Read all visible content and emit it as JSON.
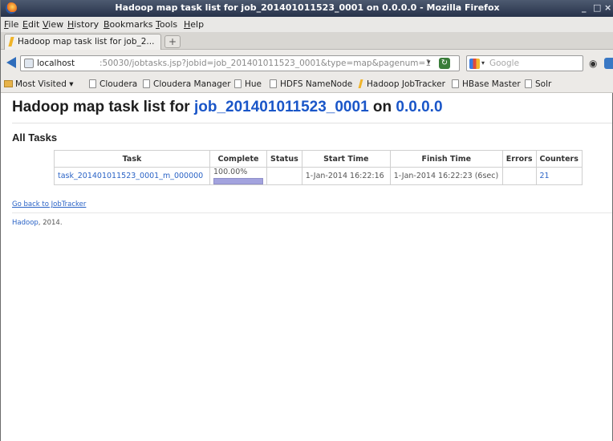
{
  "window": {
    "title": "Hadoop map task list for job_201401011523_0001 on 0.0.0.0 - Mozilla Firefox",
    "controls": [
      "_",
      "□",
      "×"
    ]
  },
  "menu": [
    "File",
    "Edit",
    "View",
    "History",
    "Bookmarks",
    "Tools",
    "Help"
  ],
  "tab": {
    "label": "Hadoop map task list for job_2...",
    "new_tab": "+"
  },
  "url": {
    "host": "localhost",
    "rest": ":50030/jobtasks.jsp?jobid=job_201401011523_0001&type=map&pagenum=1",
    "dropdown": "▾",
    "reload": "↻"
  },
  "search": {
    "placeholder": "Google"
  },
  "bookmarks": [
    "Most Visited ▾",
    "Cloudera",
    "Cloudera Manager",
    "Hue",
    "HDFS NameNode",
    "Hadoop JobTracker",
    "HBase Master",
    "Solr"
  ],
  "page": {
    "heading_prefix": "Hadoop map task list for ",
    "job_link": "job_201401011523_0001",
    "heading_middle": " on ",
    "host_link": "0.0.0.0",
    "section_title": "All Tasks",
    "table": {
      "headers": [
        "Task",
        "Complete",
        "Status",
        "Start Time",
        "Finish Time",
        "Errors",
        "Counters"
      ],
      "rows": [
        {
          "task": "task_201401011523_0001_m_000000",
          "complete": "100.00%",
          "progress": 1.0,
          "status": "",
          "start_time": "1-Jan-2014 16:22:16",
          "finish_time": "1-Jan-2014 16:22:23 (6sec)",
          "errors": "",
          "counters": "21"
        }
      ]
    },
    "go_back": "Go back to JobTracker",
    "footer_link": "Hadoop",
    "footer_text": ", 2014."
  },
  "colors": {
    "link": "#2a63c6",
    "progress": "#a3a3de",
    "titlebar": "#27324a"
  }
}
